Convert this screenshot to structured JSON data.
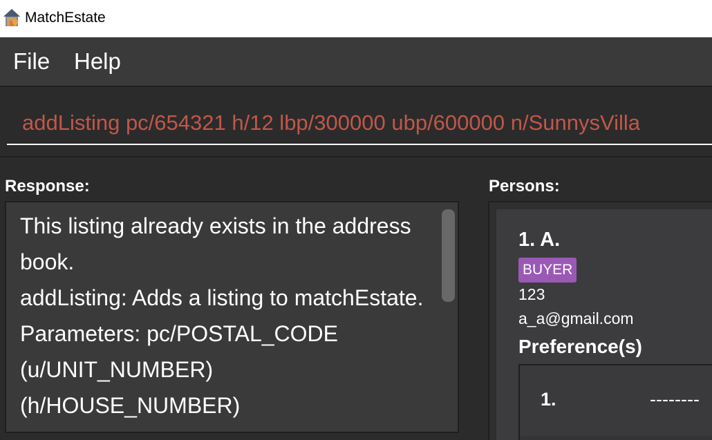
{
  "window": {
    "title": "MatchEstate",
    "icon": "house-app-icon"
  },
  "menu": {
    "items": [
      {
        "label": "File"
      },
      {
        "label": "Help"
      }
    ]
  },
  "command_box": {
    "value": "addListing pc/654321 h/12 lbp/300000 ubp/600000 n/SunnysVilla",
    "text_color": "#c1574a"
  },
  "response": {
    "label": "Response:",
    "text": "This listing already exists in the address book.\naddListing: Adds a listing to matchEstate.\nParameters: pc/POSTAL_CODE (u/UNIT_NUMBER)(h/HOUSE_NUMBER)"
  },
  "persons": {
    "label": "Persons:",
    "list": [
      {
        "name": "1. A.",
        "tag": "BUYER",
        "tag_color": "#9b59b6",
        "phone": "123",
        "email": "a_a@gmail.com",
        "preferences_heading": "Preference(s)",
        "preferences": [
          {
            "index": "1.",
            "dashes": "--------"
          }
        ]
      }
    ]
  }
}
